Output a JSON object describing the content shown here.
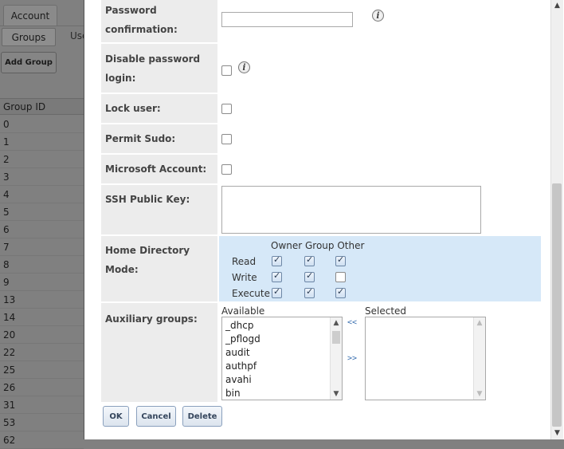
{
  "background": {
    "tab_account": "Account",
    "subtab_groups": "Groups",
    "subtab_users": "Use",
    "add_group": "Add Group",
    "table_header": "Group ID",
    "group_ids": [
      "0",
      "1",
      "2",
      "3",
      "4",
      "5",
      "6",
      "7",
      "8",
      "9",
      "13",
      "14",
      "20",
      "22",
      "25",
      "26",
      "31",
      "53",
      "62"
    ]
  },
  "form": {
    "password_confirmation_label": "Password confirmation:",
    "disable_password_login_label": "Disable password login:",
    "lock_user_label": "Lock user:",
    "permit_sudo_label": "Permit Sudo:",
    "microsoft_account_label": "Microsoft Account:",
    "ssh_public_key_label": "SSH Public Key:",
    "home_directory_mode_label": "Home Directory Mode:",
    "auxiliary_groups_label": "Auxiliary groups:",
    "info_icon_glyph": "i",
    "checkboxes": {
      "disable_password_login": false,
      "lock_user": false,
      "permit_sudo": false,
      "microsoft_account": false
    }
  },
  "permissions": {
    "header": "Owner Group Other",
    "rows": [
      {
        "label": "Read",
        "owner": true,
        "group": true,
        "other": true
      },
      {
        "label": "Write",
        "owner": true,
        "group": true,
        "other": false
      },
      {
        "label": "Execute",
        "owner": true,
        "group": true,
        "other": true
      }
    ]
  },
  "aux_groups": {
    "available_label": "Available",
    "selected_label": "Selected",
    "available": [
      "_dhcp",
      "_pflogd",
      "audit",
      "authpf",
      "avahi",
      "bin"
    ],
    "selected": [],
    "add_all_glyph": "<<",
    "remove_glyph": ">>"
  },
  "buttons": {
    "ok": "OK",
    "cancel": "Cancel",
    "delete": "Delete"
  },
  "colors": {
    "label_bg": "#ececec",
    "permissions_bg": "#d6e8f8",
    "button_border": "#8aa0bd"
  }
}
